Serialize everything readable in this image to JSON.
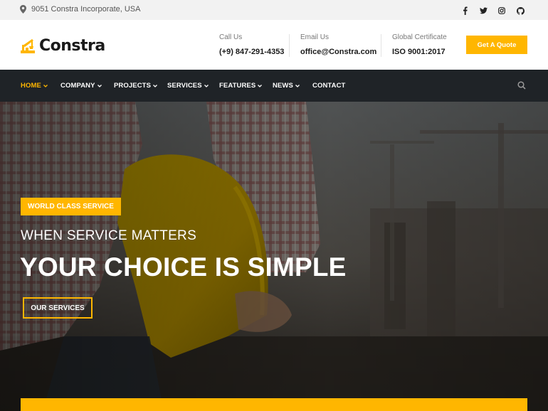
{
  "topbar": {
    "address": "9051 Constra Incorporate, USA",
    "address_icon": "map-pin-icon",
    "socials": [
      "facebook-icon",
      "twitter-icon",
      "instagram-icon",
      "github-icon"
    ]
  },
  "header": {
    "logo_text": "Constra",
    "call": {
      "label": "Call Us",
      "value": "(+9) 847-291-4353"
    },
    "email": {
      "label": "Email Us",
      "value": "office@Constra.com"
    },
    "certificate": {
      "label": "Global Certificate",
      "value": "ISO 9001:2017"
    },
    "quote_button": "Get A Quote"
  },
  "nav": {
    "items": [
      {
        "label": "HOME"
      },
      {
        "label": "COMPANY"
      },
      {
        "label": "PROJECTS"
      },
      {
        "label": "SERVICES"
      },
      {
        "label": "FEATURES"
      },
      {
        "label": "NEWS"
      },
      {
        "label": "CONTACT"
      }
    ],
    "search_icon": "search-icon"
  },
  "hero": {
    "badge": "WORLD CLASS SERVICE",
    "subtitle": "WHEN SERVICE MATTERS",
    "title": "YOUR CHOICE IS SIMPLE",
    "button": "OUR SERVICES"
  },
  "colors": {
    "accent": "#ffb600",
    "nav_bg": "#1f2327",
    "topbar_bg": "#f2f2f2"
  }
}
